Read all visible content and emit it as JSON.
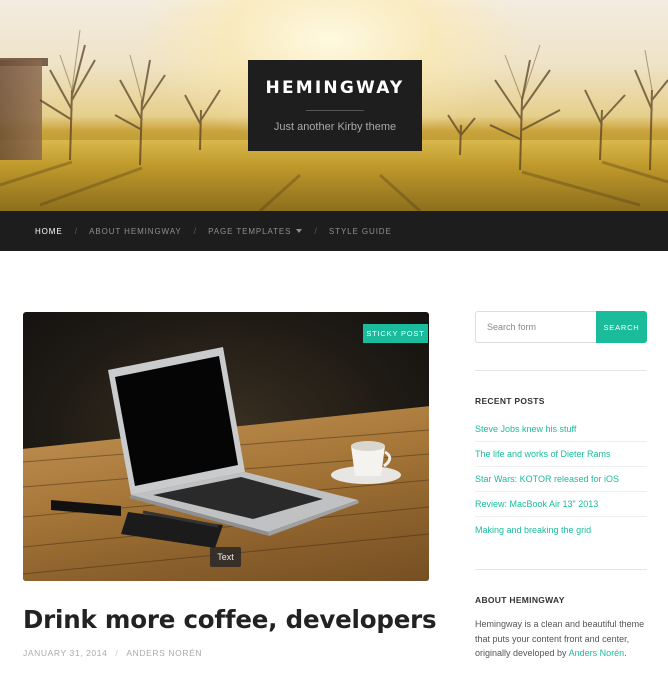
{
  "header": {
    "site_title": "HEMINGWAY",
    "tagline": "Just another Kirby theme"
  },
  "nav": {
    "items": [
      {
        "label": "HOME",
        "active": true
      },
      {
        "label": "ABOUT HEMINGWAY",
        "active": false
      },
      {
        "label": "PAGE TEMPLATES",
        "active": false,
        "has_dropdown": true
      },
      {
        "label": "STYLE GUIDE",
        "active": false
      }
    ],
    "separator": "/"
  },
  "post": {
    "badge": "STICKY POST",
    "image_caption": "Text",
    "title": "Drink more coffee, developers",
    "date": "JANUARY 31, 2014",
    "meta_separator": "/",
    "author": "ANDERS NORÉN"
  },
  "sidebar": {
    "search": {
      "placeholder": "Search form",
      "button_label": "SEARCH"
    },
    "recent_posts": {
      "title": "RECENT POSTS",
      "items": [
        "Steve Jobs knew his stuff",
        "The life and works of Dieter Rams",
        "Star Wars: KOTOR released for iOS",
        "Review: MacBook Air 13\" 2013",
        "Making and breaking the grid"
      ]
    },
    "about": {
      "title": "ABOUT HEMINGWAY",
      "text": "Hemingway is a clean and beautiful theme that puts your content front and center, originally developed by",
      "link": "Anders Norén",
      "end": "."
    }
  },
  "colors": {
    "accent": "#1abc9c",
    "nav_bg": "#1d1d1d",
    "title_box_bg": "#1e1e1e"
  },
  "icons": {
    "dropdown": "caret-down-icon"
  }
}
